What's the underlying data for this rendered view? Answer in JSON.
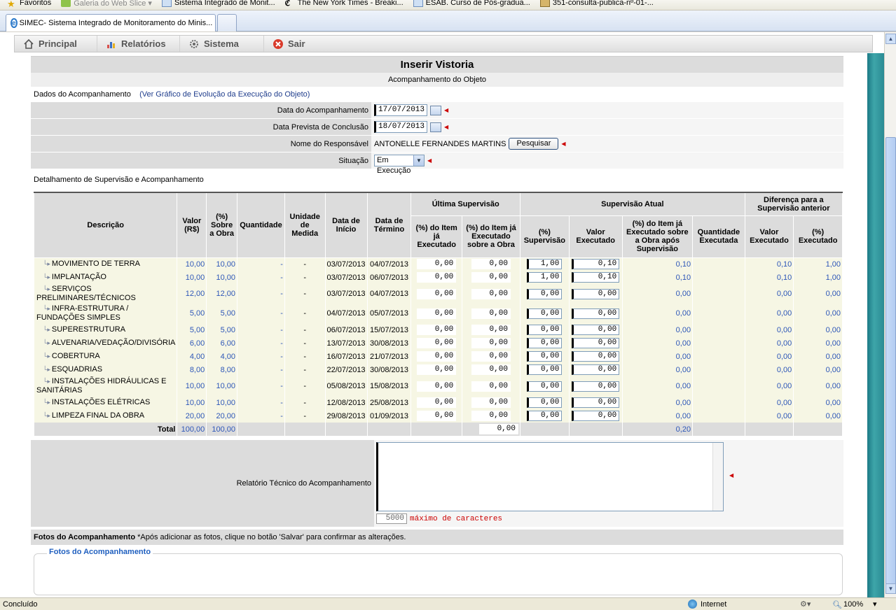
{
  "favorites_bar": {
    "items": [
      {
        "label": "Favoritos",
        "icon": "star-icon"
      },
      {
        "label": "Galeria do Web Slice ▾",
        "icon": "webslice-icon"
      },
      {
        "label": "Sistema Integrado de Monit...",
        "icon": "ie-page-icon"
      },
      {
        "label": "The New York Times - Breaki...",
        "icon": "nyt-icon"
      },
      {
        "label": "ESAB. Curso de Pós-gradua...",
        "icon": "ie-page-icon"
      },
      {
        "label": "351-consulta-publica-nº-01-...",
        "icon": "doc-icon"
      }
    ]
  },
  "browser": {
    "tab_title": "SIMEC- Sistema Integrado de Monitoramento do Minis...",
    "status_left": "Concluído",
    "status_zone": "Internet",
    "zoom": "100%"
  },
  "menu": {
    "items": [
      {
        "label": "Principal",
        "icon": "home-icon"
      },
      {
        "label": "Relatórios",
        "icon": "chart-icon"
      },
      {
        "label": "Sistema",
        "icon": "gear-icon"
      },
      {
        "label": "Sair",
        "icon": "exit-icon"
      }
    ]
  },
  "page": {
    "title": "Inserir Vistoria",
    "subtitle": "Acompanhamento do Objeto",
    "section_label": "Dados do Acompanhamento",
    "section_link": "(Ver Gráfico de Evolução da Execução do Objeto)"
  },
  "form": {
    "data_acomp_label": "Data do Acompanhamento",
    "data_acomp_value": "17/07/2013",
    "data_prev_label": "Data Prevista de Conclusão",
    "data_prev_value": "18/07/2013",
    "responsavel_label": "Nome do Responsável",
    "responsavel_value": "ANTONELLE FERNANDES MARTINS",
    "pesquisar_label": "Pesquisar",
    "situacao_label": "Situação",
    "situacao_value": "Em Execução"
  },
  "table": {
    "section_label": "Detalhamento de Supervisão e Acompanhamento",
    "headers": {
      "descricao": "Descrição",
      "valor": "Valor (R$)",
      "pct_obra": "(%) Sobre a Obra",
      "quantidade": "Quantidade",
      "unidade": "Unidade de Medida",
      "inicio": "Data de Início",
      "termino": "Data de Término",
      "ultima": "Última Supervisão",
      "atual": "Supervisão Atual",
      "diferenca": "Diferença para a Supervisão anterior",
      "u_item": "(%) do Item já Executado",
      "u_obra": "(%) do Item já Executado sobre a Obra",
      "a_sup": "(%) Supervisão",
      "a_valor": "Valor Executado",
      "a_obra": "(%) do Item já Executado sobre a Obra após Supervisão",
      "a_qtd": "Quantidade Executada",
      "d_valor": "Valor Executado",
      "d_pct": "(%) Executado"
    },
    "rows": [
      {
        "desc": "MOVIMENTO DE TERRA",
        "valor": "10,00",
        "pct": "10,00",
        "qtd": "-",
        "un": "-",
        "ini": "03/07/2013",
        "fim": "04/07/2013",
        "u_item": "0,00",
        "u_obra": "0,00",
        "sup": "1,00",
        "vexe": "0,10",
        "obra_apos": "0,10",
        "d_valor": "0,10",
        "d_pct": "1,00"
      },
      {
        "desc": "IMPLANTAÇÃO",
        "valor": "10,00",
        "pct": "10,00",
        "qtd": "-",
        "un": "-",
        "ini": "03/07/2013",
        "fim": "06/07/2013",
        "u_item": "0,00",
        "u_obra": "0,00",
        "sup": "1,00",
        "vexe": "0,10",
        "obra_apos": "0,10",
        "d_valor": "0,10",
        "d_pct": "1,00"
      },
      {
        "desc": "SERVIÇOS PRELIMINARES/TÉCNICOS",
        "valor": "12,00",
        "pct": "12,00",
        "qtd": "-",
        "un": "-",
        "ini": "03/07/2013",
        "fim": "04/07/2013",
        "u_item": "0,00",
        "u_obra": "0,00",
        "sup": "0,00",
        "vexe": "0,00",
        "obra_apos": "0,00",
        "d_valor": "0,00",
        "d_pct": "0,00"
      },
      {
        "desc": "INFRA-ESTRUTURA / FUNDAÇÕES SIMPLES",
        "valor": "5,00",
        "pct": "5,00",
        "qtd": "-",
        "un": "-",
        "ini": "04/07/2013",
        "fim": "05/07/2013",
        "u_item": "0,00",
        "u_obra": "0,00",
        "sup": "0,00",
        "vexe": "0,00",
        "obra_apos": "0,00",
        "d_valor": "0,00",
        "d_pct": "0,00"
      },
      {
        "desc": "SUPERESTRUTURA",
        "valor": "5,00",
        "pct": "5,00",
        "qtd": "-",
        "un": "-",
        "ini": "06/07/2013",
        "fim": "15/07/2013",
        "u_item": "0,00",
        "u_obra": "0,00",
        "sup": "0,00",
        "vexe": "0,00",
        "obra_apos": "0,00",
        "d_valor": "0,00",
        "d_pct": "0,00"
      },
      {
        "desc": "ALVENARIA/VEDAÇÃO/DIVISÓRIA",
        "valor": "6,00",
        "pct": "6,00",
        "qtd": "-",
        "un": "-",
        "ini": "13/07/2013",
        "fim": "30/08/2013",
        "u_item": "0,00",
        "u_obra": "0,00",
        "sup": "0,00",
        "vexe": "0,00",
        "obra_apos": "0,00",
        "d_valor": "0,00",
        "d_pct": "0,00"
      },
      {
        "desc": "COBERTURA",
        "valor": "4,00",
        "pct": "4,00",
        "qtd": "-",
        "un": "-",
        "ini": "16/07/2013",
        "fim": "21/07/2013",
        "u_item": "0,00",
        "u_obra": "0,00",
        "sup": "0,00",
        "vexe": "0,00",
        "obra_apos": "0,00",
        "d_valor": "0,00",
        "d_pct": "0,00"
      },
      {
        "desc": "ESQUADRIAS",
        "valor": "8,00",
        "pct": "8,00",
        "qtd": "-",
        "un": "-",
        "ini": "22/07/2013",
        "fim": "30/08/2013",
        "u_item": "0,00",
        "u_obra": "0,00",
        "sup": "0,00",
        "vexe": "0,00",
        "obra_apos": "0,00",
        "d_valor": "0,00",
        "d_pct": "0,00"
      },
      {
        "desc": "INSTALAÇÕES HIDRÁULICAS E SANITÁRIAS",
        "valor": "10,00",
        "pct": "10,00",
        "qtd": "-",
        "un": "-",
        "ini": "05/08/2013",
        "fim": "15/08/2013",
        "u_item": "0,00",
        "u_obra": "0,00",
        "sup": "0,00",
        "vexe": "0,00",
        "obra_apos": "0,00",
        "d_valor": "0,00",
        "d_pct": "0,00"
      },
      {
        "desc": "INSTALAÇÕES ELÉTRICAS",
        "valor": "10,00",
        "pct": "10,00",
        "qtd": "-",
        "un": "-",
        "ini": "12/08/2013",
        "fim": "25/08/2013",
        "u_item": "0,00",
        "u_obra": "0,00",
        "sup": "0,00",
        "vexe": "0,00",
        "obra_apos": "0,00",
        "d_valor": "0,00",
        "d_pct": "0,00"
      },
      {
        "desc": "LIMPEZA FINAL DA OBRA",
        "valor": "20,00",
        "pct": "20,00",
        "qtd": "-",
        "un": "-",
        "ini": "29/08/2013",
        "fim": "01/09/2013",
        "u_item": "0,00",
        "u_obra": "0,00",
        "sup": "0,00",
        "vexe": "0,00",
        "obra_apos": "0,00",
        "d_valor": "0,00",
        "d_pct": "0,00"
      }
    ],
    "total": {
      "label": "Total",
      "valor": "100,00",
      "pct": "100,00",
      "u_obra": "0,00",
      "obra_apos": "0,20"
    }
  },
  "report": {
    "label": "Relatório Técnico do Acompanhamento",
    "counter": "5000",
    "counter_text": "máximo de caracteres"
  },
  "photos": {
    "head_bold": "Fotos do Acompanhamento",
    "head_note": "*Após adicionar as fotos, clique no botão 'Salvar' para confirmar as alterações.",
    "legend": "Fotos do Acompanhamento"
  },
  "colors": {
    "link": "#2d56b8",
    "required": "#cc0000",
    "header_bg": "#dcdcdc",
    "row_bg": "#f6f6e4"
  }
}
